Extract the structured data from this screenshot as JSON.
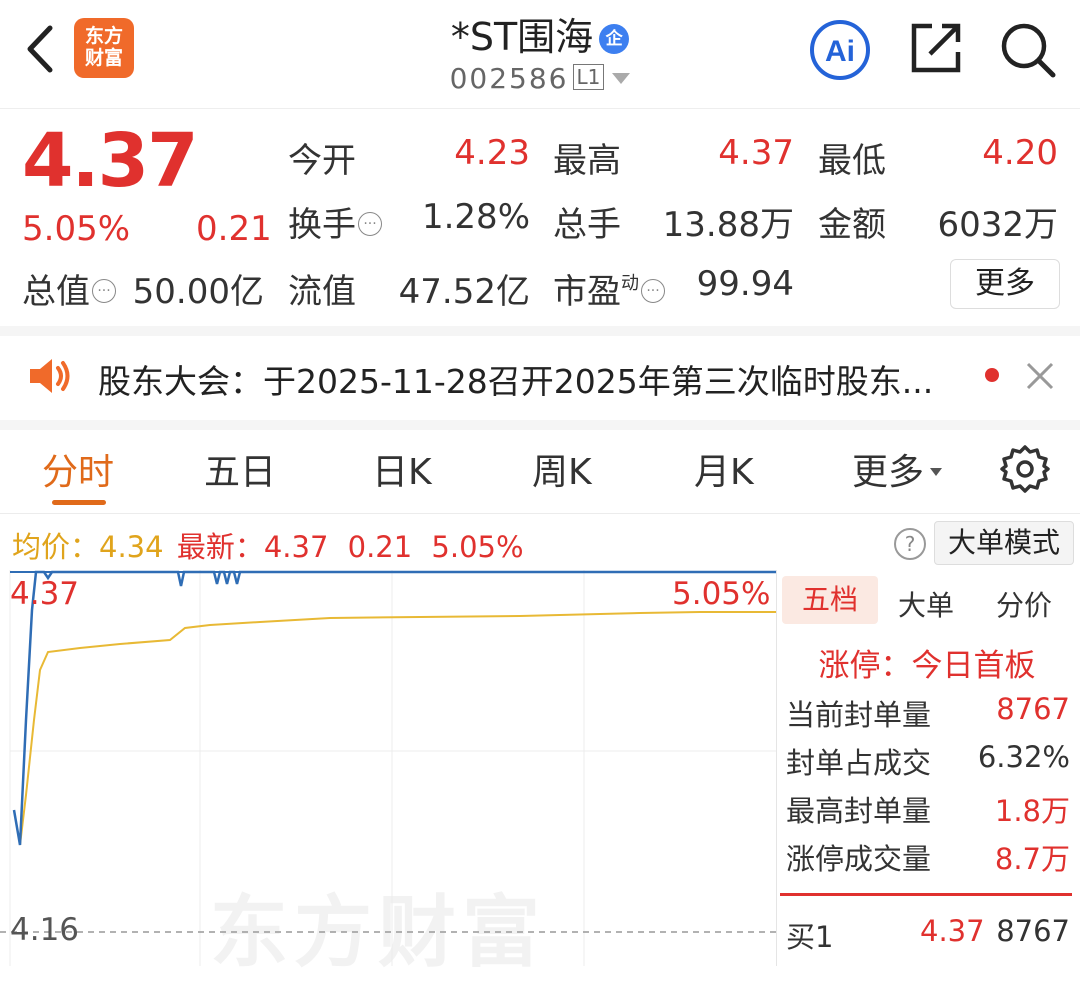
{
  "header": {
    "logo_line1": "东方",
    "logo_line2": "财富",
    "title": "*ST围海",
    "title_badge": "企",
    "code": "002586",
    "level": "L1"
  },
  "quote": {
    "price": "4.37",
    "change_pct": "5.05%",
    "change": "0.21",
    "open_label": "今开",
    "open": "4.23",
    "high_label": "最高",
    "high": "4.37",
    "low_label": "最低",
    "low": "4.20",
    "turnover_label": "换手",
    "turnover": "1.28%",
    "volume_label": "总手",
    "volume": "13.88万",
    "amount_label": "金额",
    "amount": "6032万",
    "mktcap_label": "总值",
    "mktcap": "50.00亿",
    "float_label": "流值",
    "float": "47.52亿",
    "pe_label": "市盈",
    "pe_sup": "动",
    "pe": "99.94",
    "more_label": "更多"
  },
  "notice": {
    "text": "股东大会：于2025-11-28召开2025年第三次临时股东..."
  },
  "tabs": [
    {
      "label": "分时"
    },
    {
      "label": "五日"
    },
    {
      "label": "日K"
    },
    {
      "label": "周K"
    },
    {
      "label": "月K"
    },
    {
      "label": "更多"
    }
  ],
  "infoline": {
    "avg_label": "均价：",
    "avg": "4.34",
    "latest_label": "最新：",
    "latest": "4.37",
    "chg": "0.21",
    "pct": "5.05%",
    "help_icon": "?",
    "mode_button": "大单模式"
  },
  "chart": {
    "high_label": "4.37",
    "pct_label": "5.05%",
    "low_label": "4.16",
    "watermark": "东方财富",
    "colors": {
      "price": "#2f6db5",
      "avg": "#e8b935",
      "grid": "#e6e6e6"
    }
  },
  "panel": {
    "tabs": [
      "五档",
      "大单",
      "分价"
    ],
    "limit_status": "涨停：今日首板",
    "rows": [
      {
        "label": "当前封单量",
        "value": "8767"
      },
      {
        "label": "封单占成交",
        "value": "6.32%"
      },
      {
        "label": "最高封单量",
        "value": "1.8万"
      },
      {
        "label": "涨停成交量",
        "value": "8.7万"
      }
    ],
    "bid1_label": "买1",
    "bid1_price": "4.37",
    "bid1_vol": "8767"
  }
}
